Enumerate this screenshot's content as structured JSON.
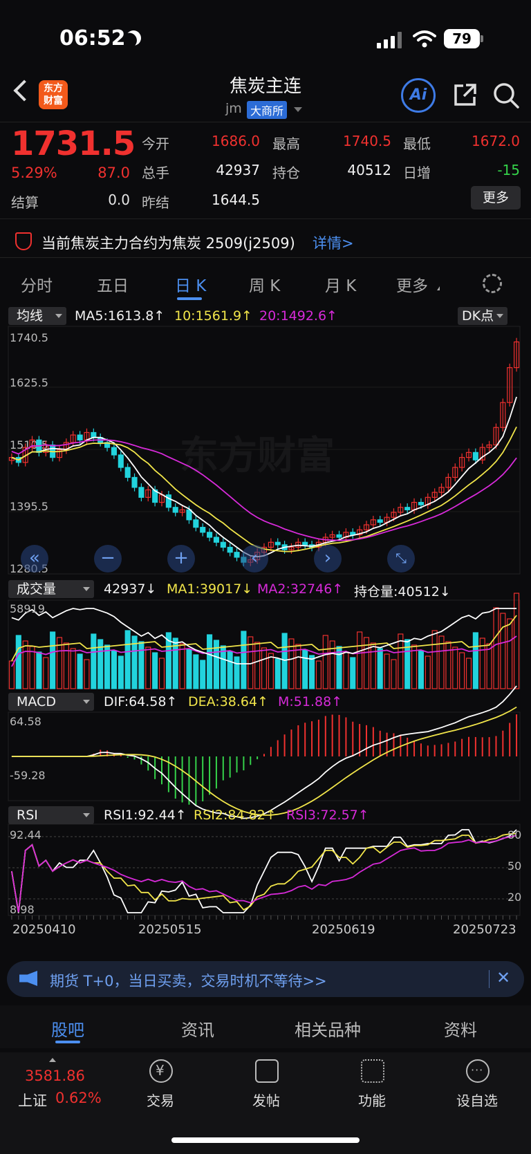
{
  "status": {
    "time": "06:52",
    "battery": "79"
  },
  "header": {
    "logo": "东方\n财富",
    "title": "焦炭主连",
    "code": "jm",
    "exchange": "大商所",
    "ai_label": "Ai"
  },
  "quote": {
    "price": "1731.5",
    "change_pct": "5.29%",
    "change": "87.0",
    "settle_label": "结算",
    "settle": "0.0",
    "open_label": "今开",
    "open": "1686.0",
    "high_label": "最高",
    "high": "1740.5",
    "low_label": "最低",
    "low": "1672.0",
    "volume_label": "总手",
    "volume": "42937",
    "oi_label": "持仓",
    "oi": "40512",
    "daily_add_label": "日增",
    "daily_add": "-15",
    "prev_settle_label": "昨结",
    "prev_settle": "1644.5",
    "more_label": "更多"
  },
  "notice": {
    "text": "当前焦炭主力合约为焦炭 2509(j2509)",
    "link": "详情>"
  },
  "tabs": [
    "分时",
    "五日",
    "日 K",
    "周 K",
    "月 K",
    "更多"
  ],
  "chart": {
    "ma_tag": "均线",
    "ma5": "MA5:1613.8↑",
    "ma10": "10:1561.9↑",
    "ma20": "20:1492.6↑",
    "dk_label": "DK点",
    "price_ticks": [
      "1740.5",
      "1625.5",
      "1510.5",
      "1395.5",
      "1280.5"
    ],
    "watermark": "东方财富",
    "vol_tag": "成交量",
    "vol_val": "42937↓",
    "vol_ma1": "MA1:39017↓",
    "vol_ma2": "MA2:32746↑",
    "vol_oi": "持仓量:40512↓",
    "vol_max": "58919",
    "macd_tag": "MACD",
    "dif": "DIF:64.58↑",
    "dea": "DEA:38.64↑",
    "macd_m": "M:51.88↑",
    "macd_max": "64.58",
    "macd_min": "-59.28",
    "rsi_tag": "RSI",
    "rsi1": "RSI1:92.44↑",
    "rsi2": "RSI2:84.82↑",
    "rsi3": "RSI3:72.57↑",
    "rsi_max": "92.44",
    "rsi_min": "8.98",
    "rsi_levels": [
      "80",
      "50",
      "20"
    ],
    "dates": [
      "20250410",
      "20250515",
      "20250619",
      "20250723"
    ]
  },
  "chart_data": {
    "type": "candlestick",
    "ylim": [
      1280.5,
      1740.5
    ],
    "closes": [
      1500,
      1490,
      1520,
      1535,
      1510,
      1525,
      1500,
      1515,
      1530,
      1545,
      1535,
      1550,
      1540,
      1530,
      1520,
      1505,
      1480,
      1460,
      1440,
      1420,
      1435,
      1410,
      1425,
      1400,
      1390,
      1395,
      1375,
      1360,
      1350,
      1340,
      1330,
      1320,
      1310,
      1300,
      1290,
      1295,
      1310,
      1320,
      1330,
      1325,
      1315,
      1320,
      1330,
      1325,
      1320,
      1330,
      1340,
      1345,
      1340,
      1350,
      1345,
      1355,
      1365,
      1375,
      1370,
      1380,
      1390,
      1400,
      1395,
      1410,
      1405,
      1420,
      1430,
      1440,
      1460,
      1480,
      1500,
      1510,
      1495,
      1520,
      1525,
      1560,
      1610,
      1680,
      1731.5
    ],
    "colors": {
      "up": "#f0312f",
      "down": "#22d3dd",
      "ma5": "#ffffff",
      "ma10": "#f1e54a",
      "ma20": "#d72ad9"
    }
  },
  "promo": {
    "text": "期货 T+0，当日买卖，交易时机不等待>>"
  },
  "bottom_tabs": [
    "股吧",
    "资讯",
    "相关品种",
    "资料"
  ],
  "footer": {
    "index_value": "3581.86",
    "index_name": "上证",
    "index_pct": "0.62%",
    "nav": [
      "交易",
      "发帖",
      "功能",
      "设自选"
    ]
  }
}
